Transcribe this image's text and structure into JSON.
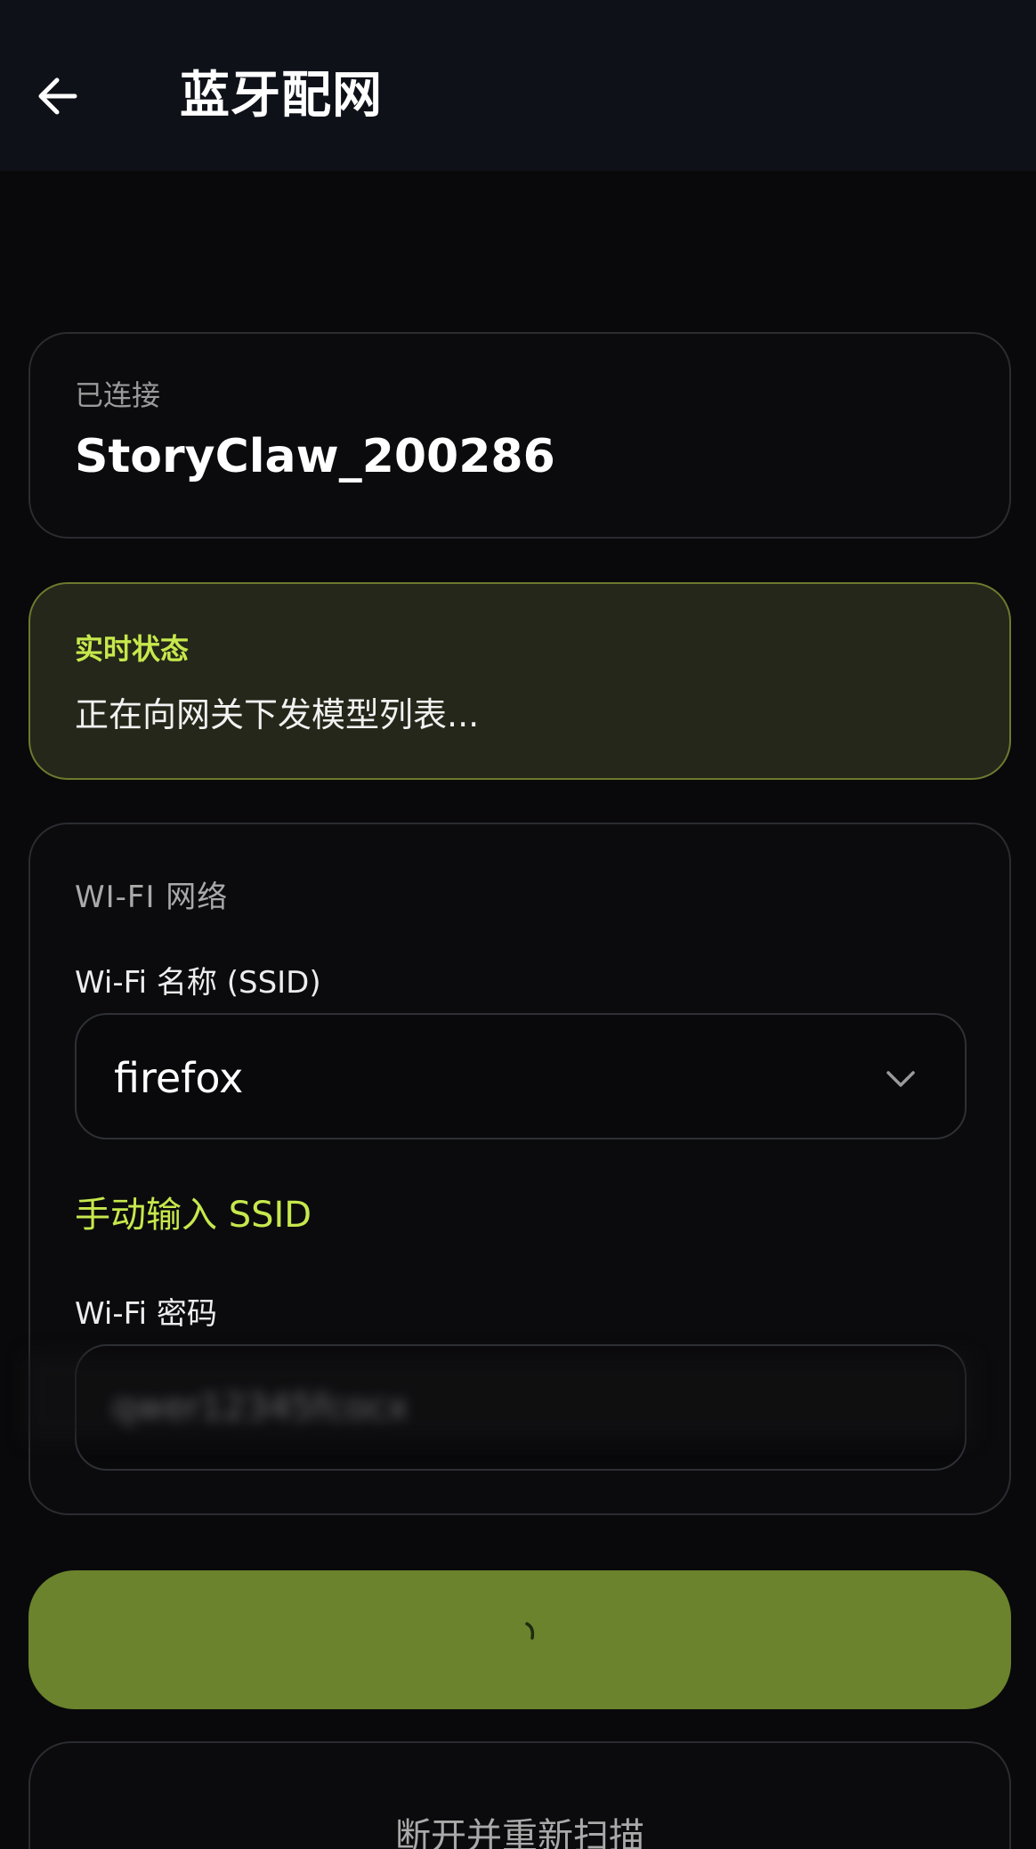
{
  "header": {
    "title": "蓝牙配网",
    "back_icon": "arrow-left-icon"
  },
  "connected": {
    "label": "已连接",
    "device_name": "StoryClaw_200286"
  },
  "status": {
    "label": "实时状态",
    "message": "正在向网关下发模型列表...",
    "accent_color": "#c7e84c"
  },
  "wifi": {
    "section_title": "WI-FI 网络",
    "ssid_label": "Wi-Fi 名称 (SSID)",
    "ssid_value": "firefox",
    "ssid_icon": "chevron-down-icon",
    "manual_link": "手动输入 SSID",
    "password_label": "Wi-Fi 密码",
    "password_value": "qwer12345fcocx"
  },
  "actions": {
    "submit_color": "#6b832c",
    "submit_state": "loading",
    "rescan_label": "断开并重新扫描"
  }
}
